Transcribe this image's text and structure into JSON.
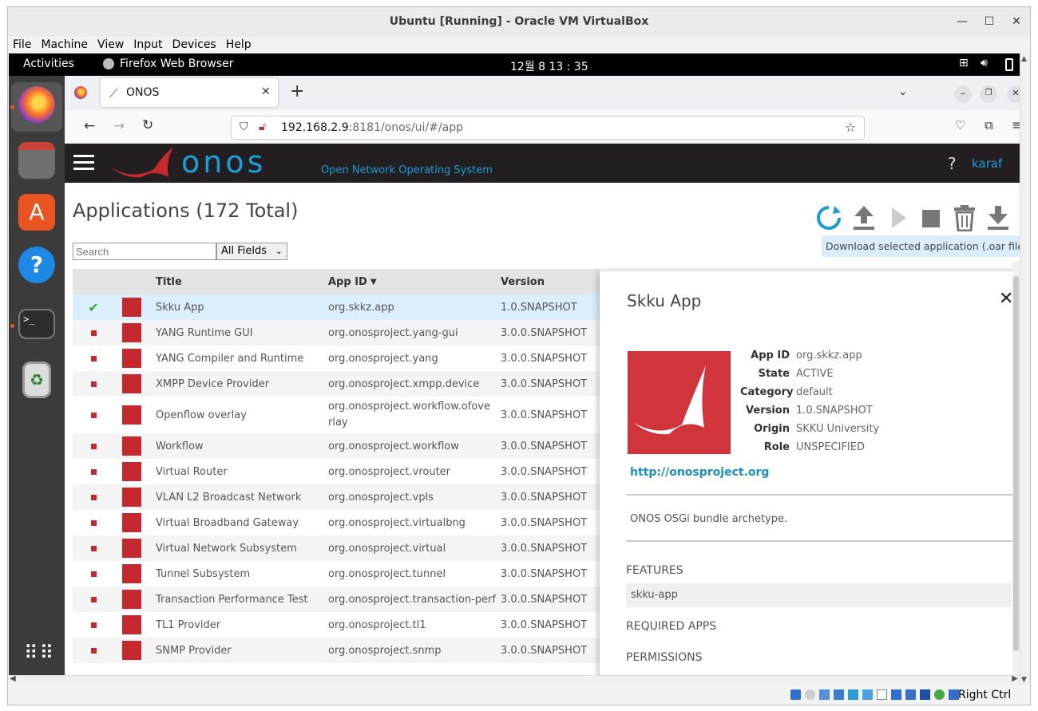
{
  "vbox": {
    "title": "Ubuntu [Running] - Oracle VM VirtualBox",
    "menu": [
      "File",
      "Machine",
      "View",
      "Input",
      "Devices",
      "Help"
    ],
    "status_text": "Right Ctrl"
  },
  "ubuntu": {
    "activities": "Activities",
    "app_name": "Firefox Web Browser",
    "clock": "12월 8  13 : 35"
  },
  "firefox": {
    "tab_title": "ONOS",
    "url_host": "192.168.2.9",
    "url_rest": ":8181/onos/ui/#/app"
  },
  "onos": {
    "logo_text": "onos",
    "subtitle": "Open Network Operating System",
    "help": "?",
    "user": "karaf",
    "apps_title": "Applications (172 Total)",
    "search_placeholder": "Search",
    "field_select": "All Fields",
    "tooltip": "Download selected application (.oar file)",
    "columns": {
      "title": "Title",
      "app_id": "App ID",
      "version": "Version"
    },
    "rows": [
      {
        "title": "Skku App",
        "id": "org.skkz.app",
        "version": "1.0.SNAPSHOT",
        "active": true
      },
      {
        "title": "YANG Runtime GUI",
        "id": "org.onosproject.yang-gui",
        "version": "3.0.0.SNAPSHOT",
        "active": false
      },
      {
        "title": "YANG Compiler and Runtime",
        "id": "org.onosproject.yang",
        "version": "3.0.0.SNAPSHOT",
        "active": false
      },
      {
        "title": "XMPP Device Provider",
        "id": "org.onosproject.xmpp.device",
        "version": "3.0.0.SNAPSHOT",
        "active": false
      },
      {
        "title": "Openflow overlay",
        "id": "org.onosproject.workflow.ofoverlay",
        "version": "3.0.0.SNAPSHOT",
        "active": false
      },
      {
        "title": "Workflow",
        "id": "org.onosproject.workflow",
        "version": "3.0.0.SNAPSHOT",
        "active": false
      },
      {
        "title": "Virtual Router",
        "id": "org.onosproject.vrouter",
        "version": "3.0.0.SNAPSHOT",
        "active": false
      },
      {
        "title": "VLAN L2 Broadcast Network",
        "id": "org.onosproject.vpls",
        "version": "3.0.0.SNAPSHOT",
        "active": false
      },
      {
        "title": "Virtual Broadband Gateway",
        "id": "org.onosproject.virtualbng",
        "version": "3.0.0.SNAPSHOT",
        "active": false
      },
      {
        "title": "Virtual Network Subsystem",
        "id": "org.onosproject.virtual",
        "version": "3.0.0.SNAPSHOT",
        "active": false
      },
      {
        "title": "Tunnel Subsystem",
        "id": "org.onosproject.tunnel",
        "version": "3.0.0.SNAPSHOT",
        "active": false
      },
      {
        "title": "Transaction Performance Test",
        "id": "org.onosproject.transaction-perf",
        "version": "3.0.0.SNAPSHOT",
        "active": false
      },
      {
        "title": "TL1 Provider",
        "id": "org.onosproject.tl1",
        "version": "3.0.0.SNAPSHOT",
        "active": false
      },
      {
        "title": "SNMP Provider",
        "id": "org.onosproject.snmp",
        "version": "3.0.0.SNAPSHOT",
        "active": false
      }
    ],
    "details": {
      "title": "Skku App",
      "app_id_label": "App ID",
      "app_id": "org.skkz.app",
      "state_label": "State",
      "state": "ACTIVE",
      "category_label": "Category",
      "category": "default",
      "version_label": "Version",
      "version": "1.0.SNAPSHOT",
      "origin_label": "Origin",
      "origin": "SKKU University",
      "role_label": "Role",
      "role": "UNSPECIFIED",
      "url": "http://onosproject.org",
      "description": "ONOS OSGi bundle archetype.",
      "features_title": "FEATURES",
      "feature": "skku-app",
      "required_title": "REQUIRED APPS",
      "permissions_title": "PERMISSIONS"
    }
  }
}
